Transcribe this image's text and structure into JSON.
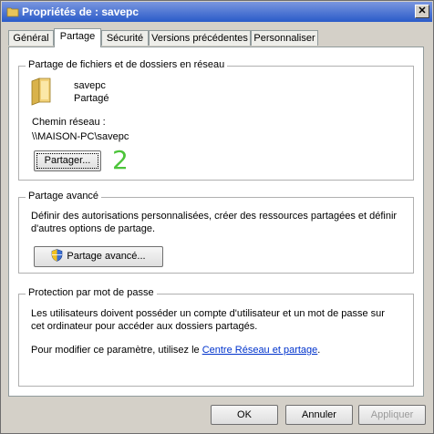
{
  "window": {
    "title": "Propriétés de : savepc",
    "close_label": "✕"
  },
  "tabs": [
    "Général",
    "Partage",
    "Sécurité",
    "Versions précédentes",
    "Personnaliser"
  ],
  "network_sharing": {
    "group_title": "Partage de fichiers et de dossiers en réseau",
    "folder_name": "savepc",
    "folder_status": "Partagé",
    "path_label": "Chemin réseau :",
    "path_value": "\\\\MAISON-PC\\savepc",
    "share_button": "Partager..."
  },
  "annotation": "2",
  "advanced_sharing": {
    "group_title": "Partage avancé",
    "description_line1": "Définir des autorisations personnalisées, créer des ressources partagées et définir",
    "description_line2": "d'autres options de partage.",
    "button": "Partage avancé..."
  },
  "password_protection": {
    "group_title": "Protection par mot de passe",
    "description_line1": "Les utilisateurs doivent posséder un compte d'utilisateur et un mot de passe sur",
    "description_line2": "cet ordinateur pour accéder aux dossiers partagés.",
    "change_text": "Pour modifier ce paramètre, utilisez le ",
    "link_text": "Centre Réseau et partage",
    "suffix": "."
  },
  "buttons": {
    "ok": "OK",
    "cancel": "Annuler",
    "apply": "Appliquer"
  },
  "colors": {
    "title_start": "#7a96df",
    "title_end": "#2a5bc9",
    "link": "#0033cc",
    "annotation": "#4cc43a"
  }
}
